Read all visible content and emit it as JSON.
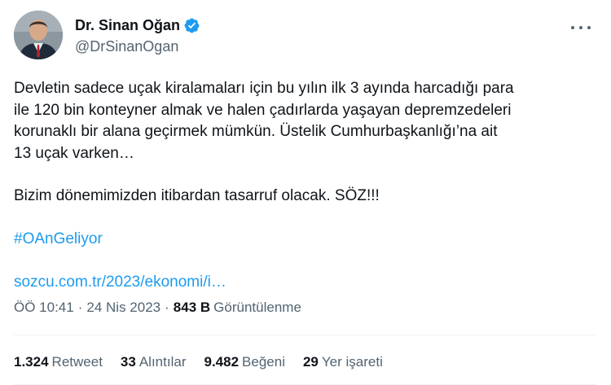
{
  "author": {
    "display_name": "Dr. Sinan Oğan",
    "handle": "@DrSinanOgan",
    "verified_color": "#1d9bf0"
  },
  "tweet": {
    "line1": "Devletin sadece uçak kiralamaları için bu yılın ilk 3 ayında harcadığı para",
    "line2": "ile 120 bin konteyner almak ve halen çadırlarda yaşayan depremzedeleri",
    "line3": "korunaklı bir alana geçirmek mümkün. Üstelik Cumhurbaşkanlığı’na ait",
    "line4": "13 uçak varken…",
    "line5": "Bizim dönemimizden itibardan tasarruf olacak. SÖZ!!!",
    "hashtag": "#OAnGeliyor",
    "link": "sozcu.com.tr/2023/ekonomi/i…"
  },
  "meta": {
    "time": "ÖÖ 10:41",
    "separator": "·",
    "date": "24 Nis 2023",
    "views_count": "843 B",
    "views_label": "Görüntülenme"
  },
  "stats": [
    {
      "count": "1.324",
      "label": "Retweet"
    },
    {
      "count": "33",
      "label": "Alıntılar"
    },
    {
      "count": "9.482",
      "label": "Beğeni"
    },
    {
      "count": "29",
      "label": "Yer işareti"
    }
  ],
  "icons": {
    "more": "more-options-icon",
    "verified": "verified-badge-icon"
  }
}
